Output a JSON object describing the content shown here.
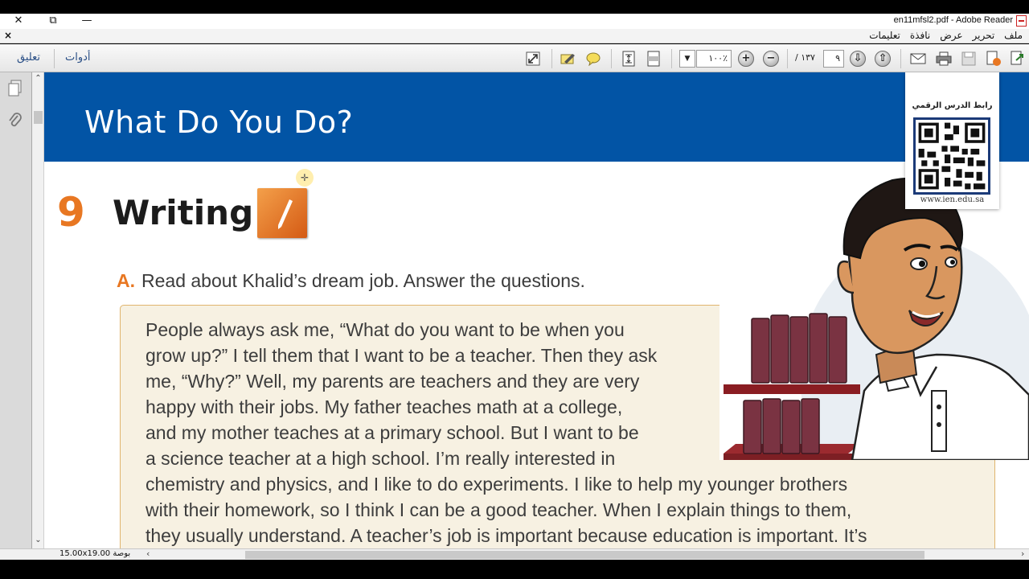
{
  "window": {
    "title": "en11mfsl2.pdf - Adobe Reader",
    "close_glyph": "✕",
    "restore_glyph": "⧉",
    "minimize_glyph": "—"
  },
  "menubar": {
    "close_doc": "×",
    "items": [
      "ملف",
      "تحرير",
      "عرض",
      "نافذة",
      "تعليمات"
    ]
  },
  "toolbar": {
    "comment_label": "تعليق",
    "tools_label": "أدوات",
    "zoom_value": "١٠٠٪",
    "page_total": "/ ١٣٧",
    "page_current": "٩",
    "zoom_in": "+",
    "zoom_out": "−",
    "prev_page": "⇩",
    "next_page": "⇧"
  },
  "navpane": {
    "pages_icon": "pages-icon",
    "attachments_icon": "paperclip-icon"
  },
  "document": {
    "banner_title": "What Do You Do?",
    "qr_label": "رابط الدرس الرقمي",
    "qr_url": "www.ien.edu.sa",
    "section_number": "9",
    "section_title": "Writing",
    "question_letter": "A.",
    "question_text": "Read about Khalid’s dream job. Answer the questions.",
    "reading_lines": [
      "People always ask me, “What do you want to be when you",
      "grow up?” I tell them that I want to be a teacher. Then they ask",
      "me, “Why?” Well, my parents are teachers and they are very",
      "happy with their jobs. My father teaches math at a college,",
      "and my mother teaches at a primary school. But I want to be",
      "a science teacher at a high school. I’m really interested in",
      "chemistry and physics, and I like to do experiments. I like to help my younger brothers",
      "with their homework, so I think I can be a good teacher. When I explain things to them,",
      "they usually understand. A teacher’s job is important because education is important. It’s"
    ]
  },
  "statusbar": {
    "page_size": "15.00x19.00 بوصة"
  },
  "colors": {
    "banner": "#0254a5",
    "accent_orange": "#e87722",
    "reading_bg": "#f7f1e2"
  }
}
